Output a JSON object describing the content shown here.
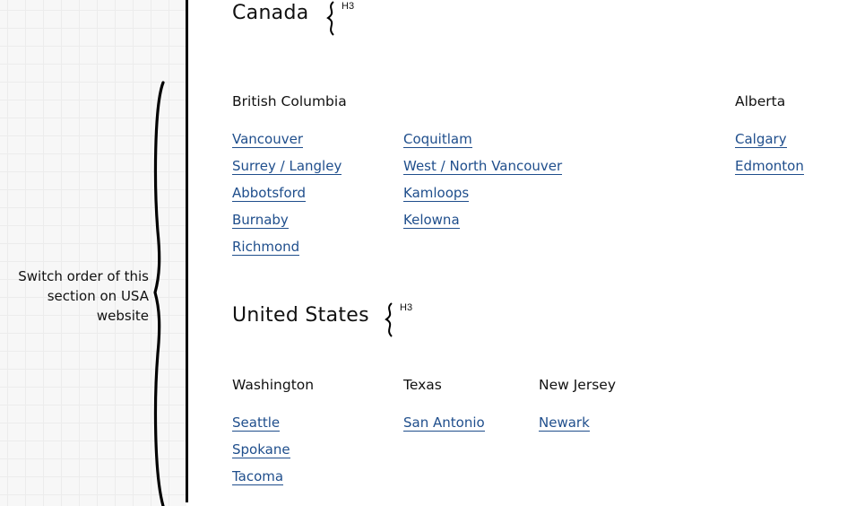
{
  "annotation": {
    "lines": [
      "Switch order of this",
      "section on USA",
      "website"
    ]
  },
  "sections": [
    {
      "country": "Canada",
      "heading_marker": "H3",
      "regions": [
        {
          "name": "British Columbia",
          "columns": [
            [
              "Vancouver",
              "Surrey / Langley",
              "Abbotsford",
              "Burnaby",
              "Richmond"
            ],
            [
              "Coquitlam",
              "West / North Vancouver",
              "Kamloops",
              "Kelowna"
            ]
          ]
        },
        {
          "name": "Alberta",
          "columns": [
            [
              "Calgary",
              "Edmonton"
            ]
          ]
        }
      ]
    },
    {
      "country": "United States",
      "heading_marker": "H3",
      "regions": [
        {
          "name": "Washington",
          "columns": [
            [
              "Seattle",
              "Spokane",
              "Tacoma"
            ]
          ]
        },
        {
          "name": "Texas",
          "columns": [
            [
              "San Antonio"
            ]
          ]
        },
        {
          "name": "New Jersey",
          "columns": [
            [
              "Newark"
            ]
          ]
        }
      ]
    }
  ],
  "colors": {
    "link": "#1f4e8c",
    "divider": "#000000",
    "grid_bg": "#f7f7f7"
  }
}
